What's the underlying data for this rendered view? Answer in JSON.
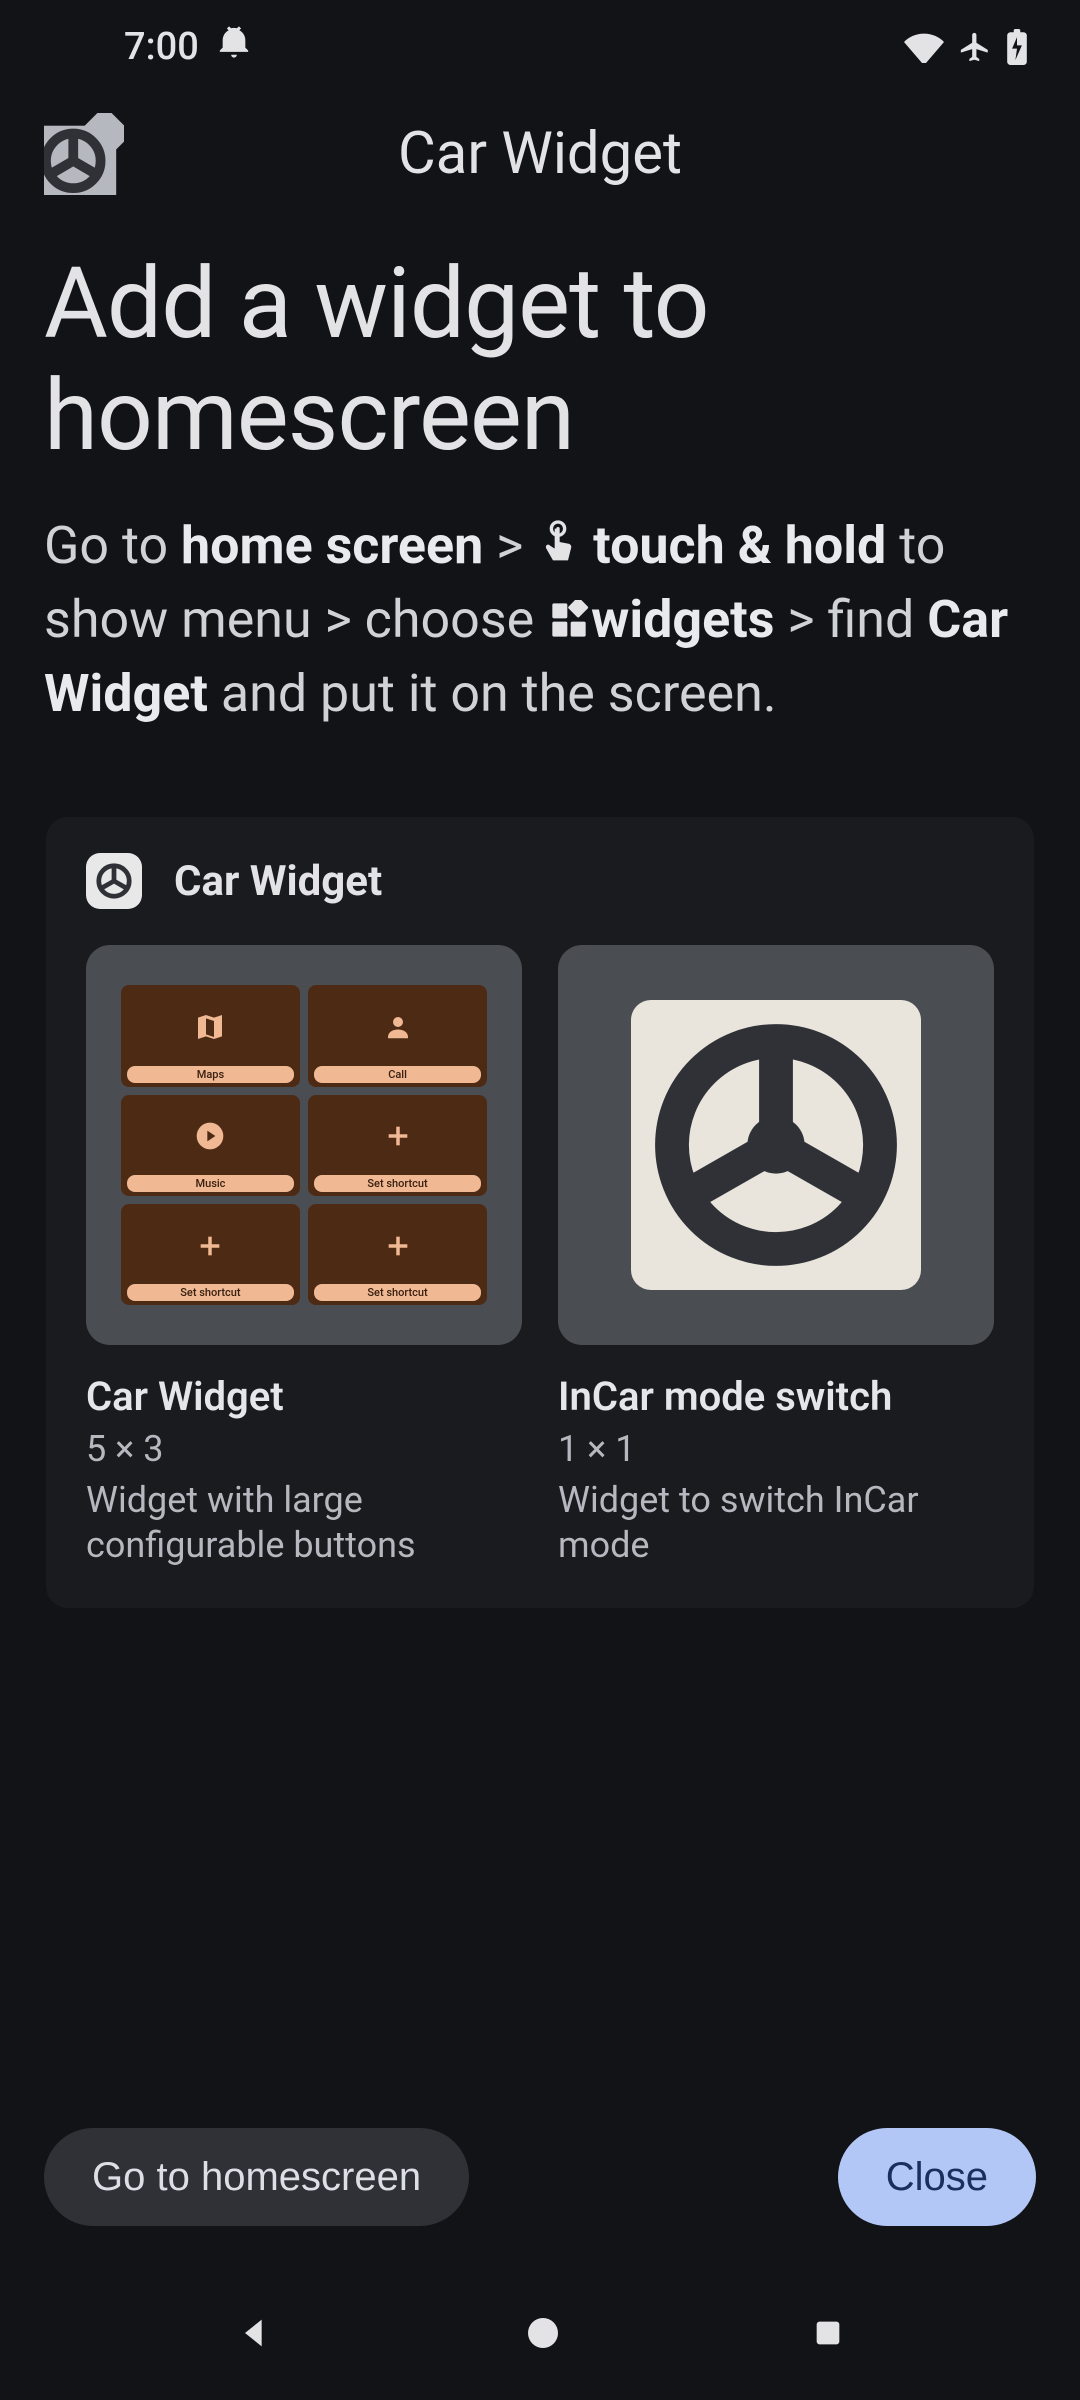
{
  "status": {
    "time": "7:00"
  },
  "header": {
    "title": "Car Widget"
  },
  "page": {
    "title": "Add a widget to homescreen"
  },
  "instructions": {
    "goto": "Go to ",
    "home_screen": "home screen",
    "sep1": " > ",
    "touch_hold": "touch & hold",
    "to_show_menu": " to show menu > choose ",
    "widgets": "widgets",
    "find": " > find ",
    "car_widget": "Car Widget",
    "tail": " and put it on the screen."
  },
  "panel": {
    "title": "Car Widget",
    "shortcuts": {
      "maps": "Maps",
      "call": "Call",
      "music": "Music",
      "set_shortcut": "Set shortcut"
    },
    "items": [
      {
        "name": "Car Widget",
        "size": "5 × 3",
        "desc": "Widget with large configurable buttons"
      },
      {
        "name": "InCar mode switch",
        "size": "1 × 1",
        "desc": "Widget to switch InCar mode"
      }
    ]
  },
  "footer": {
    "go_home": "Go to homescreen",
    "close": "Close"
  }
}
